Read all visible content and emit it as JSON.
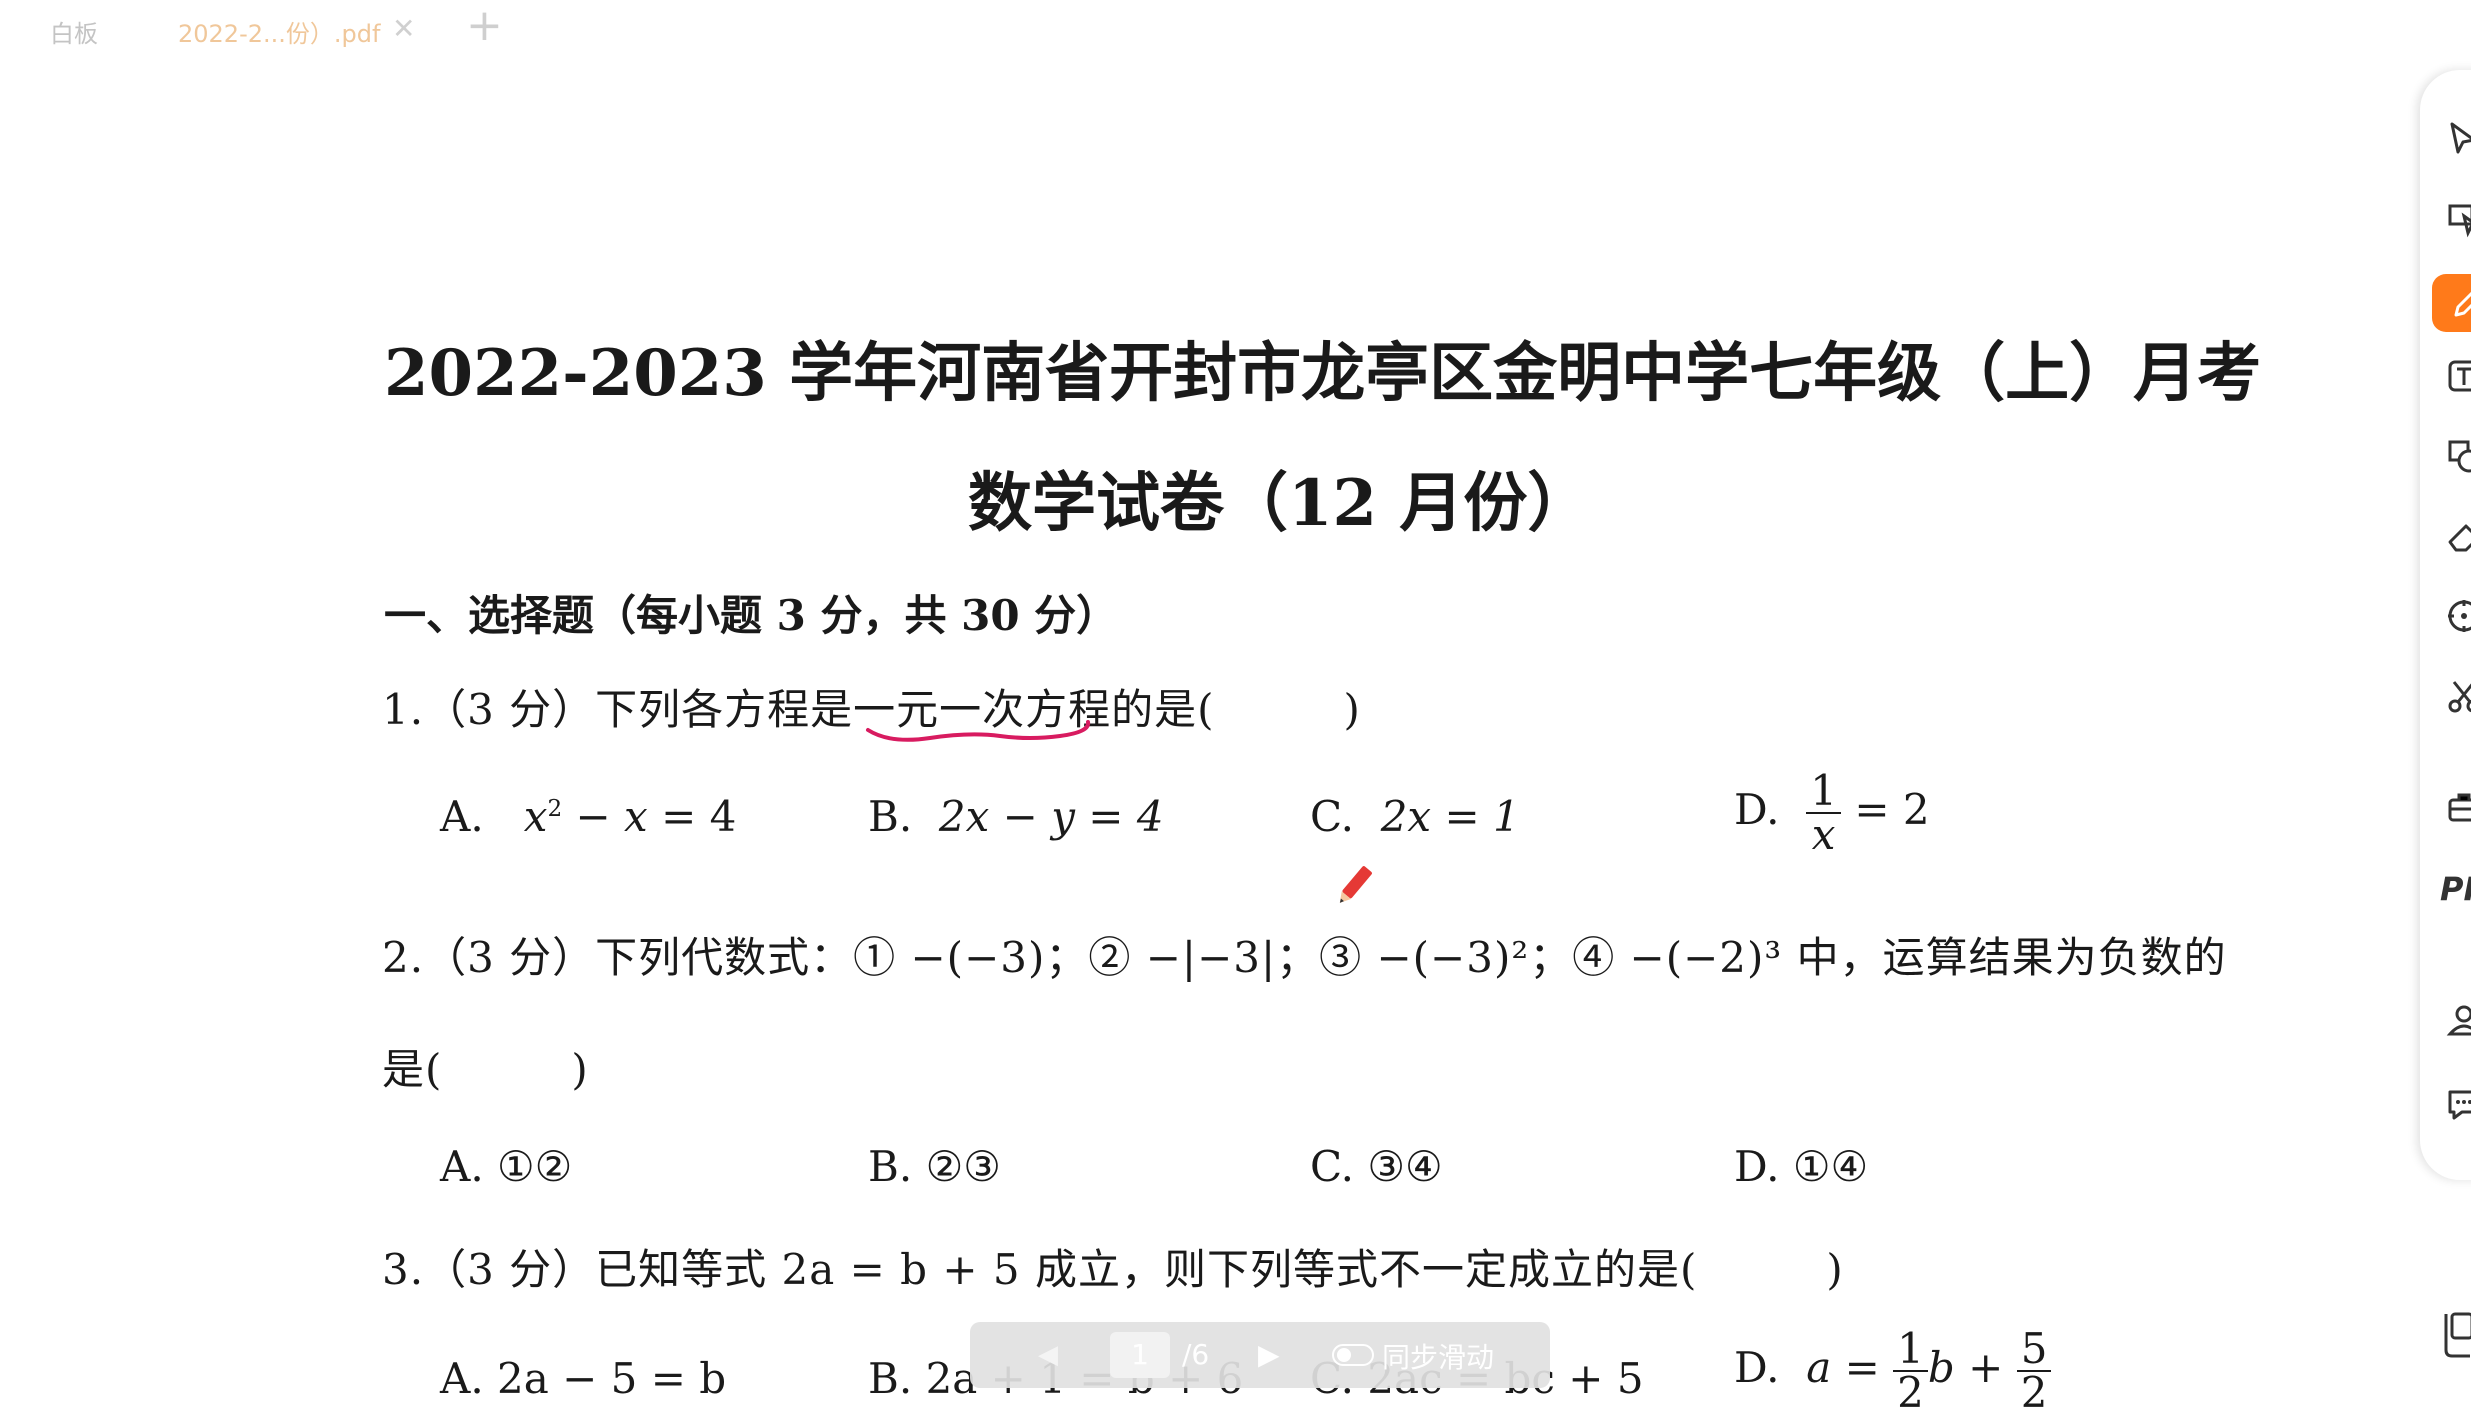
{
  "tabs": {
    "home_label": "白板",
    "file_label": "2022-2...份）.pdf",
    "close_glyph": "✕",
    "add_glyph": "+"
  },
  "doc": {
    "title_line1": "2022-2023 学年河南省开封市龙亭区金明中学七年级（上）月考",
    "title_line2": "数学试卷（12 月份）",
    "section1": "一、选择题（每小题 3 分，共 30 分）",
    "q1": {
      "stem_prefix": "1.（3 分）下列各方程是",
      "stem_underlined": "一元一次方程",
      "stem_suffix": "的是(　　　)",
      "opt_a_label": "A.",
      "opt_b_label": "B.",
      "opt_b_text": "2x − y = 4",
      "opt_c_label": "C.",
      "opt_c_text": "2x = 1",
      "opt_d_label": "D.",
      "opt_d_num": "1",
      "opt_d_den": "x",
      "opt_d_rest": "= 2"
    },
    "q2": {
      "stem_line1": "2.（3 分）下列代数式：① −(−3)；② −|−3|；③ −(−3)²；④ −(−2)³ 中，运算结果为负数的",
      "stem_line2": "是(　　　)",
      "opt_a": "A.  ①②",
      "opt_b": "B.  ②③",
      "opt_c": "C.  ③④",
      "opt_d": "D.  ①④"
    },
    "q3": {
      "stem": "3.（3 分）已知等式 2a = b + 5 成立，则下列等式不一定成立的是(　　　)",
      "opt_a": "A.  2a − 5 = b",
      "opt_b": "B.  2a + 1 = b + 6",
      "opt_c": "C.  2ac = bc + 5",
      "opt_d_label": "D.",
      "opt_d_lhs": "a = ",
      "opt_d_n1": "1",
      "opt_d_d1": "2",
      "opt_d_mid": "b + ",
      "opt_d_n2": "5",
      "opt_d_d2": "2"
    }
  },
  "pager": {
    "prev_glyph": "◀",
    "page_current": "1",
    "page_total": "/6",
    "next_glyph": "▶",
    "sync_label": "同步滑动"
  },
  "toolbar": {
    "ppt_label": "PP"
  },
  "colors": {
    "accent": "#ff7a1a",
    "annotation": "#d81b60",
    "tab_file": "#f0c79a"
  }
}
